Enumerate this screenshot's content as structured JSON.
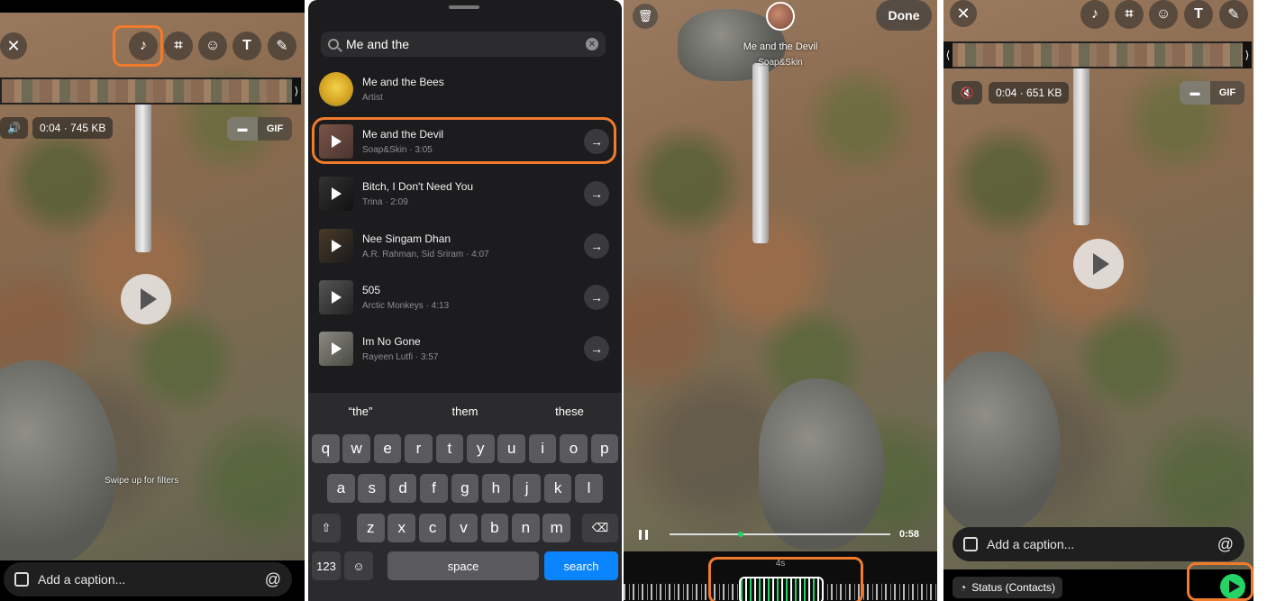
{
  "panel1": {
    "video_info": "0:04 · 745 KB",
    "mode_video": "■",
    "mode_gif": "GIF",
    "filter_hint": "Swipe up for filters",
    "caption_placeholder": "Add a caption...",
    "at_symbol": "@"
  },
  "panel2": {
    "search_value": "Me and the",
    "songs": [
      {
        "title": "Me and the Bees",
        "subtitle": "Artist"
      },
      {
        "title": "Me and the Devil",
        "subtitle": "Soap&Skin · 3:05"
      },
      {
        "title": "Bitch, I Don't Need You",
        "subtitle": "Trina · 2:09"
      },
      {
        "title": "Nee Singam Dhan",
        "subtitle": "A.R. Rahman, Sid Sriram · 4:07"
      },
      {
        "title": "505",
        "subtitle": "Arctic Monkeys · 4:13"
      },
      {
        "title": "Im No Gone",
        "subtitle": "Rayeen Lutfi · 3:57"
      }
    ],
    "suggestions": [
      "“the”",
      "them",
      "these"
    ],
    "keys_row1": [
      "q",
      "w",
      "e",
      "r",
      "t",
      "y",
      "u",
      "i",
      "o",
      "p"
    ],
    "keys_row2": [
      "a",
      "s",
      "d",
      "f",
      "g",
      "h",
      "j",
      "k",
      "l"
    ],
    "keys_row3": [
      "z",
      "x",
      "c",
      "v",
      "b",
      "n",
      "m"
    ],
    "key_123": "123",
    "key_space": "space",
    "key_search": "search"
  },
  "panel3": {
    "done_label": "Done",
    "song_title": "Me and the Devil",
    "song_artist": "Soap&Skin",
    "duration": "0:58",
    "trim_length": "4s"
  },
  "panel4": {
    "video_info": "0:04 · 651 KB",
    "mode_gif": "GIF",
    "caption_placeholder": "Add a caption...",
    "at_symbol": "@",
    "status_label": "Status (Contacts)"
  },
  "colors": {
    "highlight": "#f07b2d",
    "send": "#25d366",
    "search_key": "#0a84ff"
  }
}
